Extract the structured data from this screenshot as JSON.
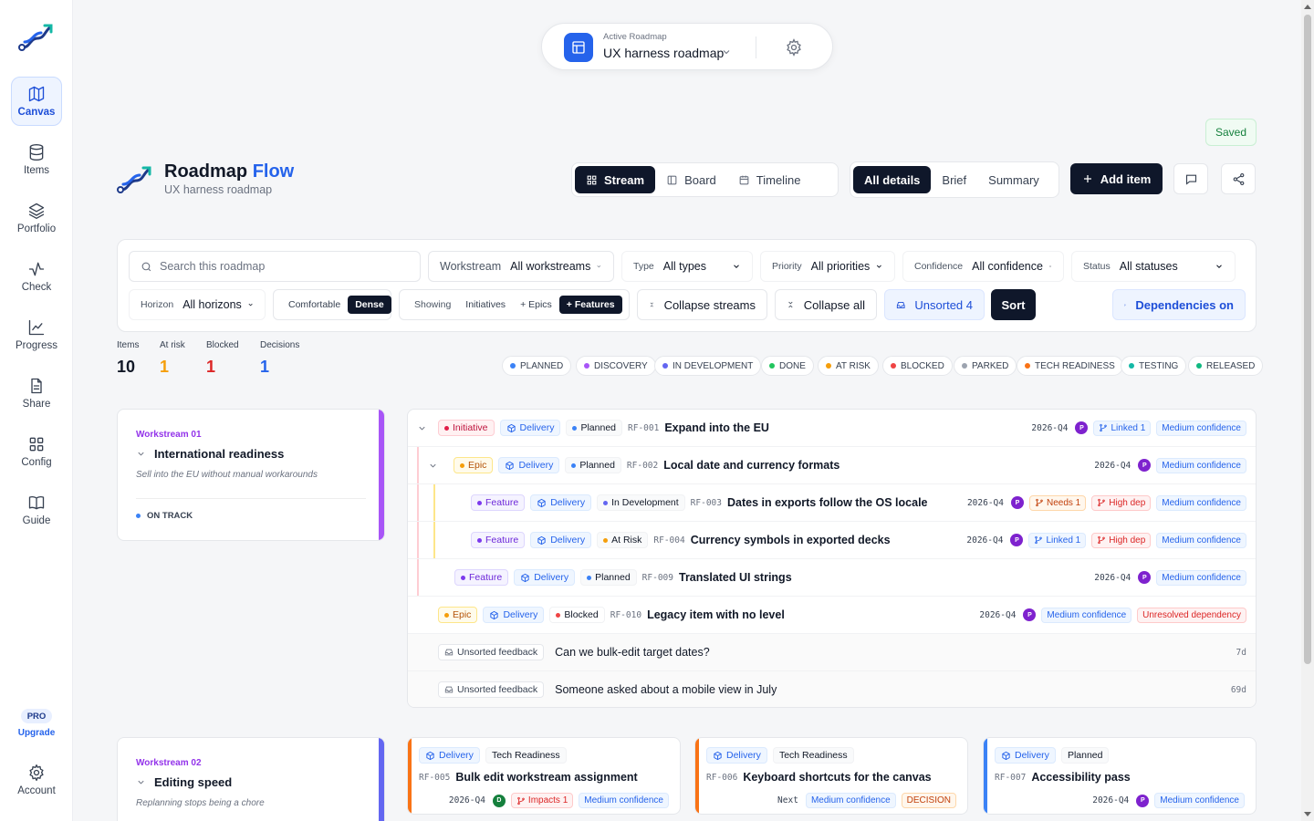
{
  "nav": {
    "items": [
      {
        "label": "Canvas",
        "icon": "map-icon"
      },
      {
        "label": "Items",
        "icon": "database-icon"
      },
      {
        "label": "Portfolio",
        "icon": "layers-icon"
      },
      {
        "label": "Check",
        "icon": "activity-icon"
      },
      {
        "label": "Progress",
        "icon": "line-chart-icon"
      },
      {
        "label": "Share",
        "icon": "document-icon"
      },
      {
        "label": "Config",
        "icon": "grid-icon"
      },
      {
        "label": "Guide",
        "icon": "book-icon"
      }
    ],
    "pro_badge": "PRO",
    "upgrade": "Upgrade",
    "account": "Account"
  },
  "active_roadmap": {
    "caption": "Active Roadmap",
    "name": "UX harness roadmap"
  },
  "saved": "Saved",
  "brand": {
    "title_a": "Roadmap",
    "title_b": "Flow",
    "subtitle": "UX harness roadmap"
  },
  "views": {
    "stream": "Stream",
    "board": "Board",
    "timeline": "Timeline"
  },
  "detail_levels": {
    "all": "All details",
    "brief": "Brief",
    "summary": "Summary"
  },
  "add_item": "Add item",
  "filters": {
    "search_placeholder": "Search this roadmap",
    "workstream": {
      "label": "Workstream",
      "value": "All workstreams"
    },
    "type": {
      "label": "Type",
      "value": "All types"
    },
    "priority": {
      "label": "Priority",
      "value": "All priorities"
    },
    "confidence": {
      "label": "Confidence",
      "value": "All confidence"
    },
    "status": {
      "label": "Status",
      "value": "All statuses"
    },
    "horizon": {
      "label": "Horizon",
      "value": "All horizons"
    },
    "density": {
      "comfortable": "Comfortable",
      "dense": "Dense"
    },
    "showing": {
      "label": "Showing",
      "initiatives": "Initiatives",
      "epics": "+ Epics",
      "features": "+ Features"
    },
    "collapse_streams": "Collapse streams",
    "collapse_all": "Collapse all",
    "unsorted": "Unsorted 4",
    "sort": "Sort",
    "dependencies": "Dependencies on"
  },
  "stats": [
    {
      "label": "Items",
      "value": "10",
      "color": "#111827"
    },
    {
      "label": "At risk",
      "value": "1",
      "color": "#f59e0b"
    },
    {
      "label": "Blocked",
      "value": "1",
      "color": "#dc2626"
    },
    {
      "label": "Decisions",
      "value": "1",
      "color": "#2563eb"
    }
  ],
  "legend": [
    {
      "label": "PLANNED",
      "color": "#3b82f6"
    },
    {
      "label": "DISCOVERY",
      "color": "#a855f7"
    },
    {
      "label": "IN DEVELOPMENT",
      "color": "#6366f1"
    },
    {
      "label": "DONE",
      "color": "#22c55e"
    },
    {
      "label": "AT RISK",
      "color": "#f59e0b"
    },
    {
      "label": "BLOCKED",
      "color": "#ef4444"
    },
    {
      "label": "PARKED",
      "color": "#9ca3af"
    },
    {
      "label": "TECH READINESS",
      "color": "#f97316"
    },
    {
      "label": "TESTING",
      "color": "#14b8a6"
    },
    {
      "label": "RELEASED",
      "color": "#10b981"
    }
  ],
  "workstreams": [
    {
      "num": "Workstream 01",
      "title": "International readiness",
      "desc": "Sell into the EU without manual workarounds",
      "status": "ON TRACK",
      "color": "#a855f7"
    },
    {
      "num": "Workstream 02",
      "title": "Editing speed",
      "desc": "Replanning stops being a chore",
      "color": "#6366f1"
    }
  ],
  "rows": [
    {
      "type": "Initiative",
      "stream": "Delivery",
      "status": "Planned",
      "status_color": "#3b82f6",
      "code": "RF-001",
      "title": "Expand into the EU",
      "quarter": "2026-Q4",
      "avatar": "P",
      "linked": "Linked 1",
      "confidence": "Medium confidence"
    },
    {
      "type": "Epic",
      "stream": "Delivery",
      "status": "Planned",
      "status_color": "#3b82f6",
      "code": "RF-002",
      "title": "Local date and currency formats",
      "quarter": "2026-Q4",
      "avatar": "P",
      "confidence": "Medium confidence"
    },
    {
      "type": "Feature",
      "stream": "Delivery",
      "status": "In Development",
      "status_color": "#6366f1",
      "code": "RF-003",
      "title": "Dates in exports follow the OS locale",
      "quarter": "2026-Q4",
      "avatar": "P",
      "needs": "Needs 1",
      "high": "High dep",
      "confidence": "Medium confidence"
    },
    {
      "type": "Feature",
      "stream": "Delivery",
      "status": "At Risk",
      "status_color": "#f59e0b",
      "code": "RF-004",
      "title": "Currency symbols in exported decks",
      "quarter": "2026-Q4",
      "avatar": "P",
      "linked": "Linked 1",
      "high": "High dep",
      "confidence": "Medium confidence"
    },
    {
      "type": "Feature",
      "stream": "Delivery",
      "status": "Planned",
      "status_color": "#3b82f6",
      "code": "RF-009",
      "title": "Translated UI strings",
      "quarter": "2026-Q4",
      "avatar": "P",
      "confidence": "Medium confidence"
    },
    {
      "type": "Epic",
      "stream": "Delivery",
      "status": "Blocked",
      "status_color": "#ef4444",
      "code": "RF-010",
      "title": "Legacy item with no level",
      "quarter": "2026-Q4",
      "avatar": "P",
      "confidence": "Medium confidence",
      "unresolved": "Unresolved dependency"
    }
  ],
  "feedback": [
    {
      "tag": "Unsorted feedback",
      "text": "Can we bulk-edit target dates?",
      "age": "7d"
    },
    {
      "tag": "Unsorted feedback",
      "text": "Someone asked about a mobile view in July",
      "age": "69d"
    }
  ],
  "cards": [
    {
      "stream": "Delivery",
      "status": "Tech Readiness",
      "code": "RF-005",
      "title": "Bulk edit workstream assignment",
      "quarter": "2026-Q4",
      "avatar": "D",
      "impacts": "Impacts 1",
      "confidence": "Medium confidence",
      "color": "#f97316"
    },
    {
      "stream": "Delivery",
      "status": "Tech Readiness",
      "code": "RF-006",
      "title": "Keyboard shortcuts for the canvas",
      "quarter": "Next",
      "confidence": "Medium confidence",
      "decision": "DECISION",
      "color": "#f97316"
    },
    {
      "stream": "Delivery",
      "status": "Planned",
      "code": "RF-007",
      "title": "Accessibility pass",
      "quarter": "2026-Q4",
      "avatar": "P",
      "confidence": "Medium confidence",
      "color": "#3b82f6"
    }
  ]
}
